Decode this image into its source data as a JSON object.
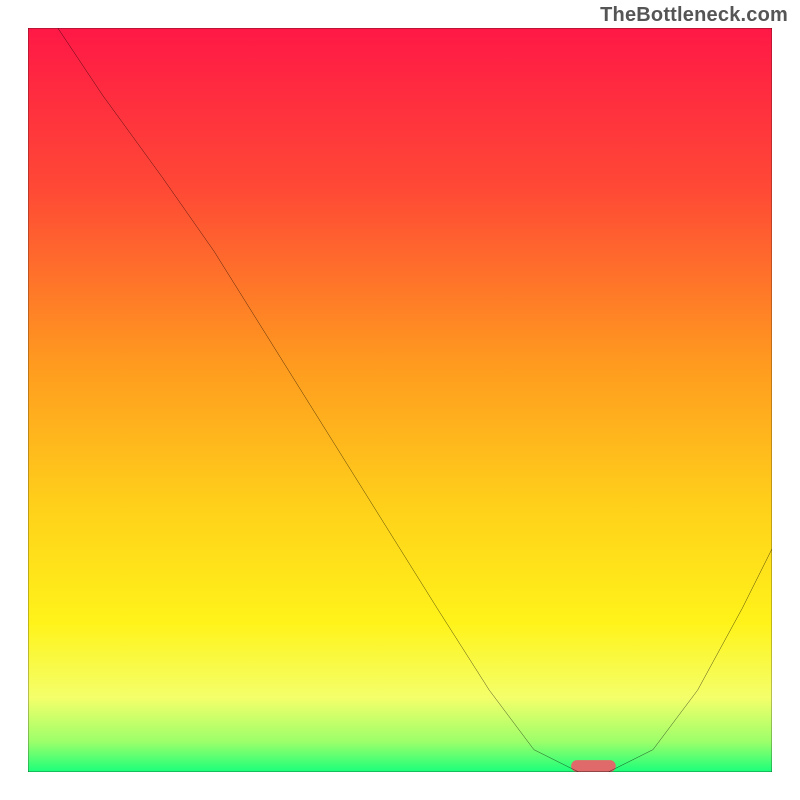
{
  "watermark": "TheBottleneck.com",
  "chart_data": {
    "type": "line",
    "title": "",
    "xlabel": "",
    "ylabel": "",
    "xlim": [
      0,
      100
    ],
    "ylim": [
      0,
      100
    ],
    "grid": false,
    "series": [
      {
        "name": "curve",
        "x": [
          4,
          10,
          18,
          25,
          35,
          45,
          55,
          62,
          68,
          74,
          78,
          84,
          90,
          96,
          100
        ],
        "values": [
          100,
          91,
          80,
          70,
          54,
          38,
          22,
          11,
          3,
          0,
          0,
          3,
          11,
          22,
          30
        ]
      }
    ],
    "optimum_marker": {
      "x": 76,
      "width": 6
    },
    "gradient_stops": [
      {
        "pct": 0,
        "color": "#ff1846"
      },
      {
        "pct": 22,
        "color": "#ff4a35"
      },
      {
        "pct": 45,
        "color": "#ff9a1f"
      },
      {
        "pct": 65,
        "color": "#ffd21a"
      },
      {
        "pct": 80,
        "color": "#fff31a"
      },
      {
        "pct": 90,
        "color": "#f4ff6a"
      },
      {
        "pct": 96,
        "color": "#9aff6a"
      },
      {
        "pct": 100,
        "color": "#1aff7a"
      }
    ]
  }
}
